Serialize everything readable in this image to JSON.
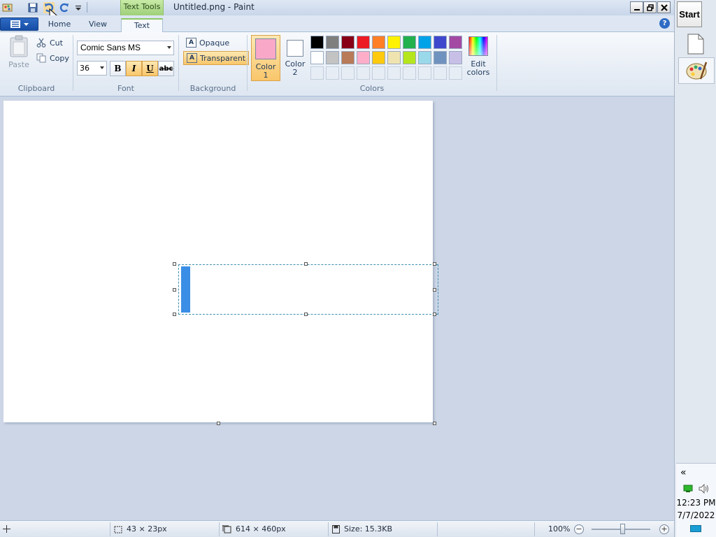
{
  "window": {
    "title": "Untitled.png - Paint",
    "context_tab": "Text Tools"
  },
  "tabs": [
    {
      "label": "Home"
    },
    {
      "label": "View"
    },
    {
      "label": "Text",
      "active": true
    }
  ],
  "clipboard": {
    "paste": "Paste",
    "cut": "Cut",
    "copy": "Copy",
    "group_label": "Clipboard"
  },
  "font": {
    "family": "Comic Sans MS",
    "size": "36",
    "bold": "B",
    "italic": "I",
    "underline": "U",
    "strikethrough": "abc",
    "active_styles": [
      "italic",
      "underline"
    ],
    "group_label": "Font"
  },
  "background": {
    "opaque": "Opaque",
    "transparent": "Transparent",
    "selected": "transparent",
    "group_label": "Background"
  },
  "colors": {
    "color1_label": "Color 1",
    "color2_label": "Color 2",
    "color1": "#f9a8c8",
    "color2": "#ffffff",
    "edit_label": "Edit colors",
    "group_label": "Colors",
    "palette_row1": [
      "#000000",
      "#7f7f7f",
      "#880015",
      "#ed1c24",
      "#ff7f27",
      "#fff200",
      "#22b14c",
      "#00a2e8",
      "#3f48cc",
      "#a349a4"
    ],
    "palette_row2": [
      "#ffffff",
      "#c3c3c3",
      "#b97a57",
      "#ffaec9",
      "#ffc90e",
      "#efe4b0",
      "#b5e61d",
      "#99d9ea",
      "#7092be",
      "#c8bfe7"
    ]
  },
  "canvas": {
    "text_content": "",
    "caret_color": "#3a8ee6"
  },
  "status": {
    "selection_size": "43 × 23px",
    "image_size": "614 × 460px",
    "file_size": "Size: 15.3KB",
    "zoom": "100%"
  },
  "taskbar": {
    "start": "Start",
    "time": "12:23 PM",
    "date": "7/7/2022",
    "collapse": "«"
  }
}
